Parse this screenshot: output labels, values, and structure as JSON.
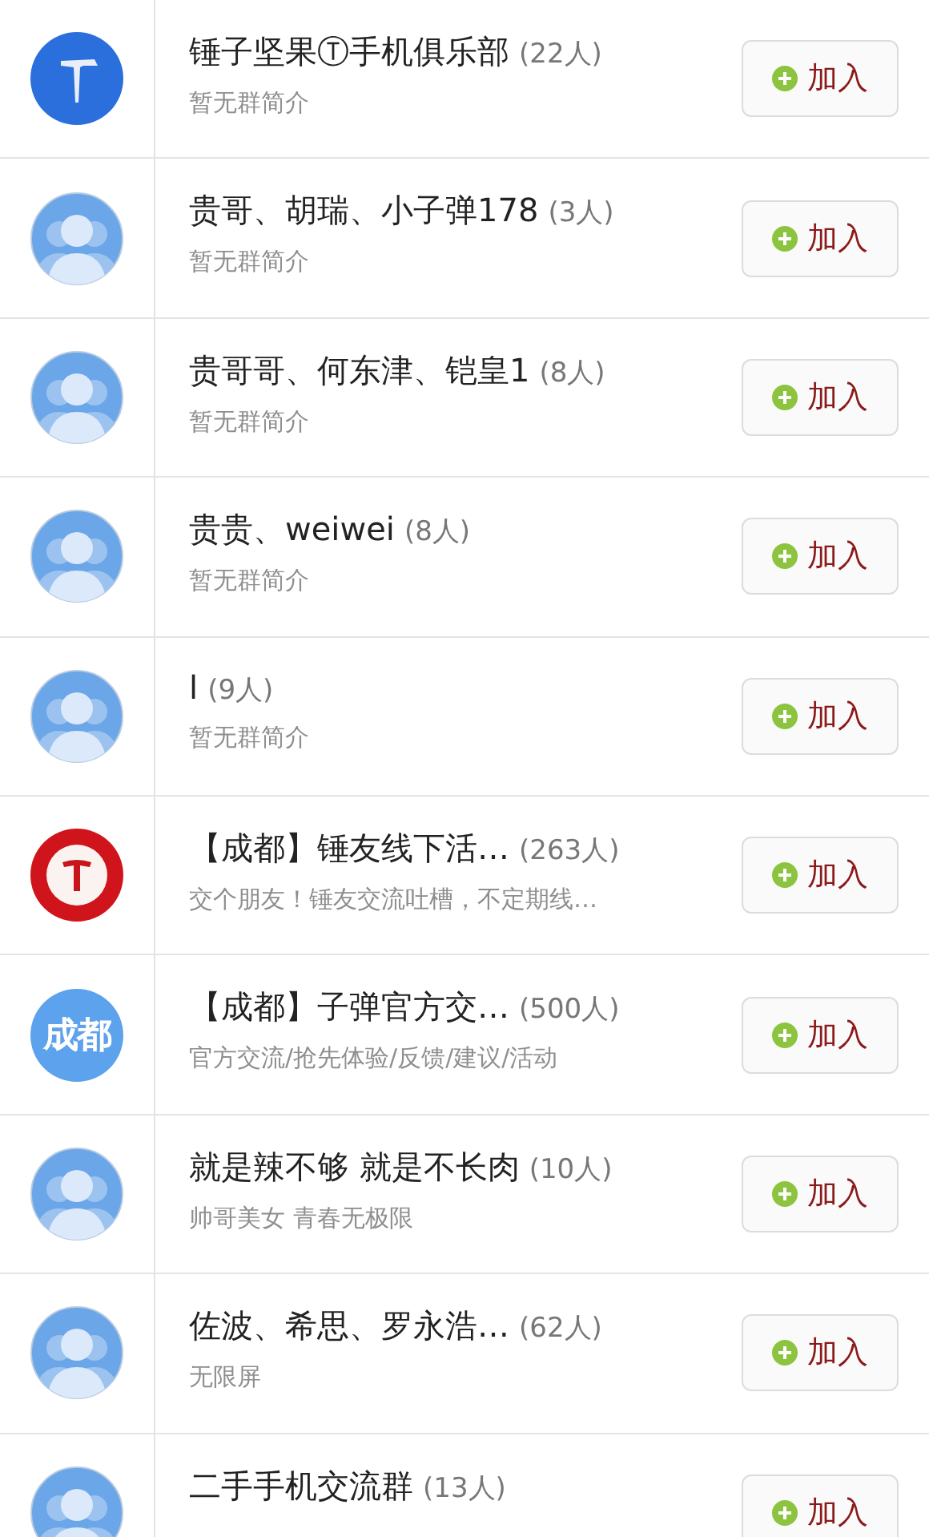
{
  "groups": [
    {
      "avatar": {
        "kind": "hammer"
      },
      "name": "锤子坚果Ⓣ手机俱乐部",
      "count": "(22人)",
      "description": "暂无群简介",
      "button": "加入"
    },
    {
      "avatar": {
        "kind": "default"
      },
      "name": "贵哥、胡瑞、小子弹178",
      "count": "(3人)",
      "description": "暂无群简介",
      "button": "加入"
    },
    {
      "avatar": {
        "kind": "default"
      },
      "name": "贵哥哥、何东津、铠皇1",
      "count": "(8人)",
      "description": "暂无群简介",
      "button": "加入"
    },
    {
      "avatar": {
        "kind": "default"
      },
      "name": "贵贵、weiwei",
      "count": "(8人)",
      "description": "暂无群简介",
      "button": "加入"
    },
    {
      "avatar": {
        "kind": "default"
      },
      "name": "l",
      "count": "(9人)",
      "description": "暂无群简介",
      "button": "加入"
    },
    {
      "avatar": {
        "kind": "t-logo"
      },
      "name": "【成都】锤友线下活…",
      "count": "(263人)",
      "description": "交个朋友！锤友交流吐槽，不定期线…",
      "button": "加入"
    },
    {
      "avatar": {
        "kind": "text",
        "text": "成都"
      },
      "name": "【成都】子弹官方交…",
      "count": "(500人)",
      "description": "官方交流/抢先体验/反馈/建议/活动",
      "button": "加入"
    },
    {
      "avatar": {
        "kind": "default"
      },
      "name": "就是辣不够 就是不长肉",
      "count": "(10人)",
      "description": "帅哥美女 青春无极限",
      "button": "加入"
    },
    {
      "avatar": {
        "kind": "default"
      },
      "name": "佐波、希思、罗永浩…",
      "count": "(62人)",
      "description": "无限屏",
      "button": "加入"
    },
    {
      "avatar": {
        "kind": "default"
      },
      "name": "二手手机交流群",
      "count": "(13人)",
      "button": "加入"
    }
  ]
}
